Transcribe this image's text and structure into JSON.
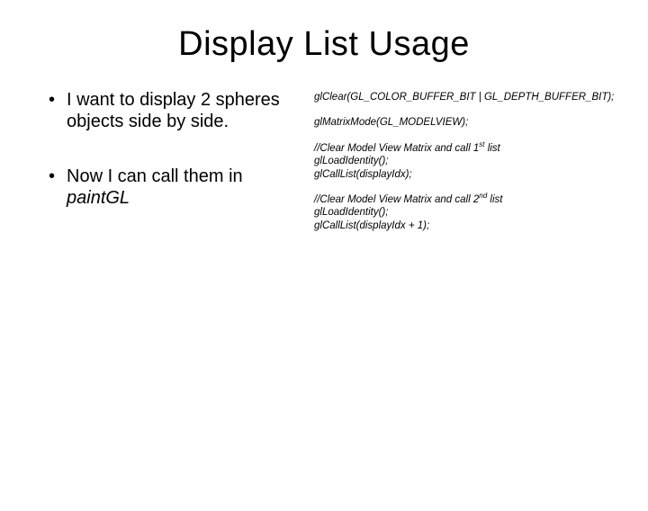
{
  "title": "Display List Usage",
  "bullets": {
    "b1": "I want to display 2 spheres objects side by side.",
    "b2_pre": "Now I can call them in ",
    "b2_em": "paintGL"
  },
  "code": {
    "l1": "glClear(GL_COLOR_BUFFER_BIT | GL_DEPTH_BUFFER_BIT);",
    "l2": "glMatrixMode(GL_MODELVIEW);",
    "c1_a": "//Clear Model View Matrix and call 1",
    "c1_sup": "st",
    "c1_b": " list",
    "l3": "glLoadIdentity();",
    "l4": "glCallList(displayIdx);",
    "c2_a": "//Clear Model View Matrix and call 2",
    "c2_sup": "nd",
    "c2_b": " list",
    "l5": "glLoadIdentity();",
    "l6": "glCallList(displayIdx + 1);"
  }
}
